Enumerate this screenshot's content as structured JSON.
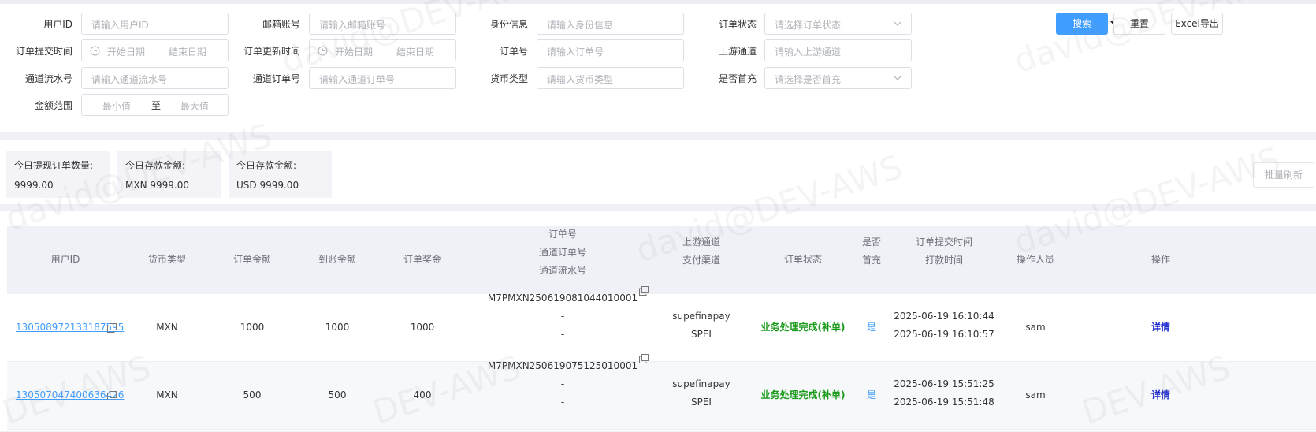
{
  "filters": {
    "user_id": {
      "label": "用户ID",
      "placeholder": "请输入用户ID"
    },
    "email": {
      "label": "邮箱账号",
      "placeholder": "请输入邮箱账号"
    },
    "identity": {
      "label": "身份信息",
      "placeholder": "请输入身份信息"
    },
    "order_status": {
      "label": "订单状态",
      "placeholder": "请选择订单状态"
    },
    "submit_time": {
      "label": "订单提交时间",
      "start": "开始日期",
      "sep": "-",
      "end": "结束日期"
    },
    "update_time": {
      "label": "订单更新时间",
      "start": "开始日期",
      "sep": "-",
      "end": "结束日期"
    },
    "order_no": {
      "label": "订单号",
      "placeholder": "请输入订单号"
    },
    "upstream": {
      "label": "上游通道",
      "placeholder": "请输入上游通道"
    },
    "channel_serial": {
      "label": "通道流水号",
      "placeholder": "请输入通道流水号"
    },
    "channel_order": {
      "label": "通道订单号",
      "placeholder": "请输入通道订单号"
    },
    "currency": {
      "label": "货币类型",
      "placeholder": "请输入货币类型"
    },
    "first_deposit": {
      "label": "是否首充",
      "placeholder": "请选择是否首充"
    },
    "amount_range": {
      "label": "金额范围",
      "min": "最小值",
      "to": "至",
      "max": "最大值"
    }
  },
  "buttons": {
    "search": "搜索",
    "reset": "重置",
    "export": "Excel导出",
    "batch_refresh": "批量刷新"
  },
  "stats": [
    {
      "title": "今日提现订单数量:",
      "value": "9999.00"
    },
    {
      "title": "今日存款金额:",
      "value": "MXN 9999.00"
    },
    {
      "title": "今日存款金额:",
      "value": "USD 9999.00"
    }
  ],
  "table": {
    "headers": {
      "user_id": "用户ID",
      "currency": "货币类型",
      "order_amount": "订单金额",
      "received": "到账金额",
      "bonus": "订单奖金",
      "order_no_1": "订单号",
      "order_no_2": "通道订单号",
      "order_no_3": "通道流水号",
      "upstream_1": "上游通道",
      "upstream_2": "支付渠道",
      "status": "订单状态",
      "first_1": "是否",
      "first_2": "首充",
      "time_1": "订单提交时间",
      "time_2": "打款时间",
      "operator": "操作人员",
      "action": "操作"
    },
    "rows": [
      {
        "user_id": "130508972133187595",
        "currency": "MXN",
        "order_amount": "1000",
        "received": "1000",
        "bonus": "1000",
        "order_no": "M7PMXN250619081044010001",
        "channel_order": "-",
        "channel_serial": "-",
        "upstream": "supefinapay",
        "pay_channel": "SPEI",
        "status": "业务处理完成(补单)",
        "first": "是",
        "submit_time": "2025-06-19 16:10:44",
        "pay_time": "2025-06-19 16:10:57",
        "operator": "sam",
        "action": "详情"
      },
      {
        "user_id": "130507047400636426",
        "currency": "MXN",
        "order_amount": "500",
        "received": "500",
        "bonus": "400",
        "order_no": "M7PMXN250619075125010001",
        "channel_order": "-",
        "channel_serial": "-",
        "upstream": "supefinapay",
        "pay_channel": "SPEI",
        "status": "业务处理完成(补单)",
        "first": "是",
        "submit_time": "2025-06-19 15:51:25",
        "pay_time": "2025-06-19 15:51:48",
        "operator": "sam",
        "action": "详情"
      }
    ]
  },
  "watermark": {
    "text_a": "david@DEV-AWS",
    "text_b": "DEV-AWS"
  },
  "colors": {
    "primary": "#409eff",
    "status_green": "#1a9a1a",
    "action_link": "#1f2bd0"
  }
}
